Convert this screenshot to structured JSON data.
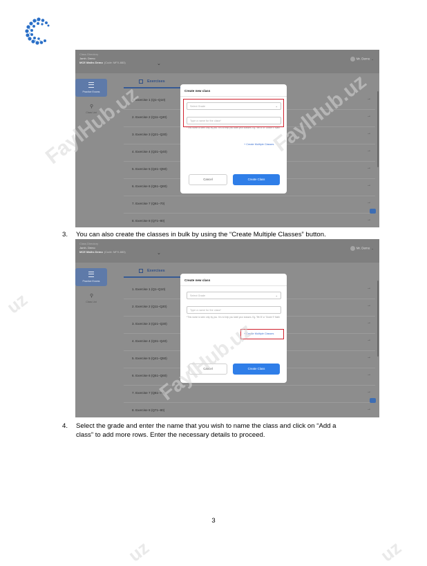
{
  "watermark": "FaylHub.uz",
  "watermark_fragments": [
    "uz",
    "uz",
    "uz"
  ],
  "app": {
    "breadcrumb_top": "Class Directory",
    "school": "Jamh. Demo",
    "workbook": "MCE Maths Demo",
    "workbook_code": "(Code: MFX-883)",
    "user": "Mr. Demo",
    "side_practice": "Practice Exams",
    "side_class": "Class List",
    "exercises_header": "Exercises",
    "exercises": [
      "1. Exercise 1 (Q1–Q10)",
      "2. Exercise 2 (Q11–Q20)",
      "3. Exercise 3 (Q21–Q30)",
      "4. Exercise 4 (Q31–Q40)",
      "5. Exercise 5 (Q41–Q50)",
      "6. Exercise 6 (Q51–Q60)",
      "7. Exercise 7 (Q61–70)",
      "8. Exercise 8 (Q71–80)"
    ]
  },
  "modal": {
    "title": "Create new class",
    "select_placeholder": "Select Grade",
    "name_placeholder": "Type a name for the class*",
    "hint": "*This name is seen only by you. It is to help you label your classes. Eg. '9th B' or 'Grade 9' Math",
    "multi_link": "+ Create Multiple Classes",
    "cancel": "Cancel",
    "create": "Create Class"
  },
  "step3": {
    "number": "3.",
    "text": "You can also create the classes in bulk by using the “Create Multiple Classes” button."
  },
  "step4": {
    "number": "4.",
    "text_line1": "Select the grade and enter the name that you wish to name the class and click on “Add a",
    "text_line2": "class” to add more rows. Enter the necessary details to proceed."
  },
  "page_number": "3",
  "colors": {
    "highlight": "#d01f2c",
    "primary_button": "#2f7ee8",
    "logo": "#2a6fc7"
  }
}
